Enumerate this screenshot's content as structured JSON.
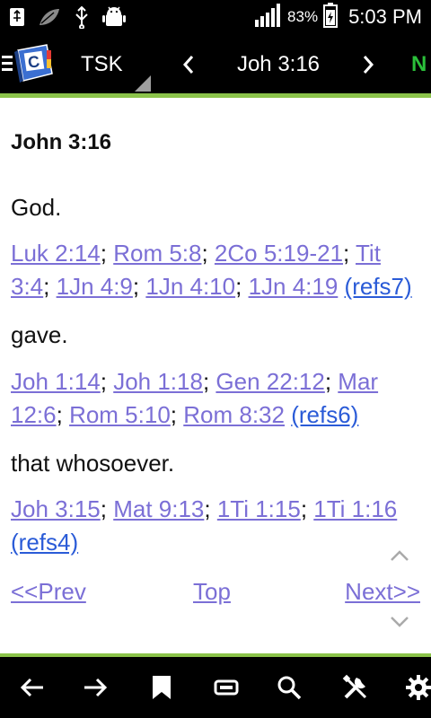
{
  "status_bar": {
    "battery_percent": "83%",
    "time": "5:03 PM",
    "icons": [
      "usb-icon",
      "leaf-icon",
      "usb-debug-icon",
      "android-icon",
      "signal-icon",
      "battery-charging-icon"
    ]
  },
  "action_bar": {
    "module": "TSK",
    "reference": "Joh 3:16",
    "overflow_text": "N"
  },
  "content": {
    "title": "John 3:16",
    "sections": [
      {
        "word": "God.",
        "links": [
          "Luk 2:14",
          "Rom 5:8",
          "2Co 5:19-21",
          "Tit 3:4",
          "1Jn 4:9",
          "1Jn 4:10",
          "1Jn 4:19"
        ],
        "refs": "(refs7)"
      },
      {
        "word": "gave.",
        "links": [
          "Joh 1:14",
          "Joh 1:18",
          "Gen 22:12",
          "Mar 12:6",
          "Rom 5:10",
          "Rom 8:32"
        ],
        "refs": "(refs6)"
      },
      {
        "word": "that whosoever.",
        "links": [
          "Joh 3:15",
          "Mat 9:13",
          "1Ti 1:15",
          "1Ti 1:16"
        ],
        "refs": "(refs4)"
      }
    ],
    "nav": {
      "prev": "<<Prev",
      "top": "Top",
      "next": "Next>>"
    }
  },
  "toolbar": {
    "icons": [
      "back-arrow-icon",
      "forward-arrow-icon",
      "bookmark-icon",
      "card-icon",
      "search-icon",
      "tools-icon",
      "settings-icon"
    ]
  },
  "colors": {
    "accent": "#8bc34a",
    "link": "#7b6fd6",
    "refs_link": "#2a5bd7",
    "overflow_green": "#2bbf3a"
  }
}
